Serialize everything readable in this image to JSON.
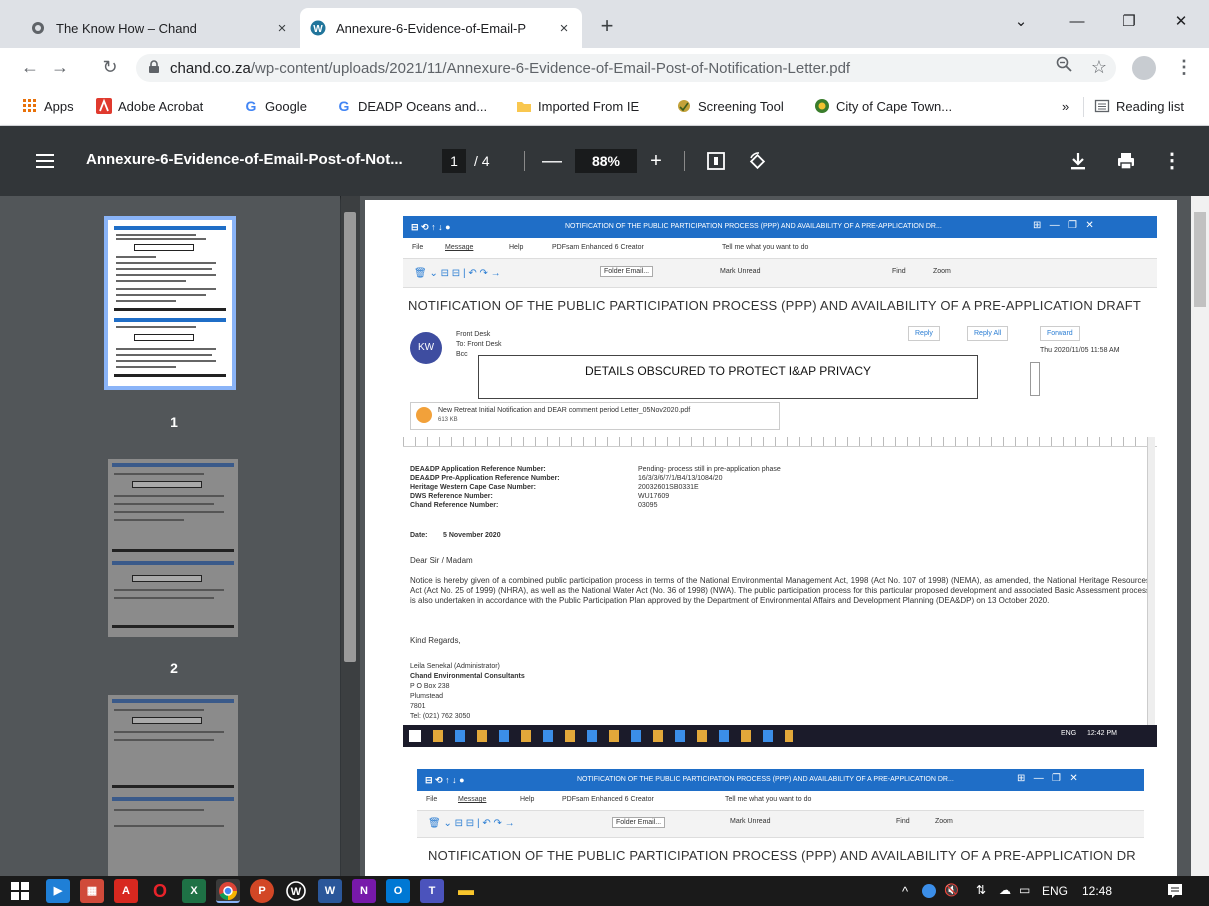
{
  "browser": {
    "tabs": [
      {
        "title": "The Know How – Chand",
        "close": "×"
      },
      {
        "title": "Annexure-6-Evidence-of-Email-P",
        "close": "×"
      }
    ],
    "new_tab": "+",
    "url_host": "chand.co.za",
    "url_path": "/wp-content/uploads/2021/11/Annexure-6-Evidence-of-Email-Post-of-Notification-Letter.pdf",
    "bookmarks": [
      {
        "label": "Apps",
        "icon": "apps-grid-icon",
        "color": "#e8710a"
      },
      {
        "label": "Adobe Acrobat",
        "icon": "adobe-acrobat-icon",
        "color": "#e03a2e"
      },
      {
        "label": "Google",
        "icon": "google-icon",
        "color": "#4285f4"
      },
      {
        "label": "DEADP Oceans and...",
        "icon": "google-icon",
        "color": "#4285f4"
      },
      {
        "label": "Imported From IE",
        "icon": "folder-icon",
        "color": "#f9c74f"
      },
      {
        "label": "Screening Tool",
        "icon": "screening-tool-icon",
        "color": "#7a9b3a"
      },
      {
        "label": "City of Cape Town...",
        "icon": "city-cape-town-icon",
        "color": "#3a7d2c"
      }
    ],
    "more_bookmarks": "»",
    "reading_list": "Reading list"
  },
  "pdf": {
    "filename": "Annexure-6-Evidence-of-Email-Post-of-Not...",
    "current_page": "1",
    "total_pages": "/ 4",
    "zoom": "88%",
    "thumbnails": [
      "1",
      "2"
    ]
  },
  "document": {
    "outlook_title": "NOTIFICATION OF THE PUBLIC PARTICIPATION PROCESS (PPP) AND AVAILABILITY OF A PRE-APPLICATION DR...",
    "ribbon_tabs": [
      "File",
      "Message",
      "Help",
      "PDFsam Enhanced 6 Creator",
      "Tell me what you want to do"
    ],
    "ribbon_tools": [
      "Folder Email...",
      "Mark Unread",
      "Find",
      "Zoom"
    ],
    "subject": "NOTIFICATION OF THE PUBLIC PARTICIPATION PROCESS (PPP) AND AVAILABILITY OF A PRE-APPLICATION DRAFT B...",
    "avatar": "KW",
    "sender": "Front Desk",
    "to": "To: Front Desk",
    "bcc": "Bcc",
    "date": "Thu 2020/11/05 11:58 AM",
    "actions": [
      "Reply",
      "Reply All",
      "Forward"
    ],
    "privacy_note": "DETAILS OBSCURED TO PROTECT I&AP PRIVACY",
    "attachment_name": "New Retreat Initial Notification and DEAR comment period Letter_05Nov2020.pdf",
    "attachment_size": "613 KB",
    "refs": [
      [
        "DEA&DP Application Reference Number:",
        "Pending- process still in pre-application phase"
      ],
      [
        "DEA&DP Pre-Application Reference Number:",
        "16/3/3/6/7/1/B4/13/1084/20"
      ],
      [
        "Heritage Western Cape Case Number:",
        "20032601SB0331E"
      ],
      [
        "DWS Reference Number:",
        "WU17609"
      ],
      [
        "Chand Reference Number:",
        "03095"
      ]
    ],
    "date_label": "Date:",
    "date_value": "5 November 2020",
    "salutation": "Dear Sir / Madam",
    "body": "Notice is hereby given of a combined public participation process in terms of the National Environmental Management Act, 1998 (Act No. 107 of 1998) (NEMA), as amended, the National Heritage Resources Act (Act No. 25 of 1999) (NHRA), as well as the National Water Act (No. 36 of 1998) (NWA). The public participation process for this particular proposed development and associated Basic Assessment process is also undertaken in accordance with the Public Participation Plan approved by the Department of Environmental Affairs and Development Planning (DEA&DP) on 13 October 2020.",
    "regards": "Kind Regards,",
    "signature": [
      "Leila Senekal (Administrator)",
      "Chand Environmental Consultants",
      "P O Box 238",
      "Plumstead",
      "7801",
      "Tel: (021) 762 3050"
    ],
    "screenshot_clock": "12:42 PM",
    "screenshot_lang": "ENG"
  },
  "taskbar": {
    "apps": [
      "start-icon",
      "media-player-icon",
      "calendar-app-icon",
      "acrobat-icon",
      "opera-icon",
      "excel-icon",
      "chrome-icon",
      "powerpoint-icon",
      "wordpress-icon",
      "word-icon",
      "onenote-icon",
      "outlook-icon",
      "teams-icon",
      "file-explorer-icon"
    ],
    "language": "ENG",
    "time": "12:48"
  }
}
